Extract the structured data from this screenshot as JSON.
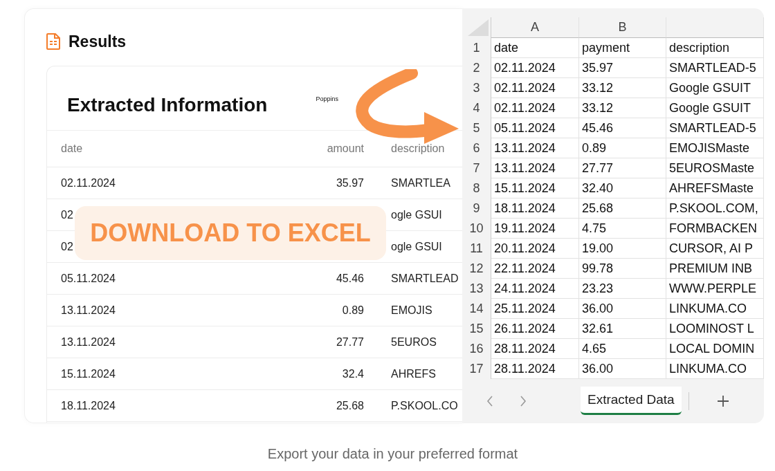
{
  "results": {
    "title": "Results",
    "card": {
      "title": "Extracted Information",
      "font_label": "Poppins",
      "table": {
        "columns": [
          "date",
          "amount",
          "description"
        ],
        "rows": [
          {
            "date": "02.11.2024",
            "amount": "35.97",
            "description": "SMARTLEA"
          },
          {
            "date": "02",
            "description": "ogle GSUI"
          },
          {
            "date": "02",
            "description": "ogle GSUI"
          },
          {
            "date": "05.11.2024",
            "amount": "45.46",
            "description": "SMARTLEAD"
          },
          {
            "date": "13.11.2024",
            "amount": "0.89",
            "description": "EMOJIS"
          },
          {
            "date": "13.11.2024",
            "amount": "27.77",
            "description": "5EUROS"
          },
          {
            "date": "15.11.2024",
            "amount": "32.4",
            "description": "AHREFS"
          },
          {
            "date": "18.11.2024",
            "amount": "25.68",
            "description": "P.SKOOL.CO"
          }
        ]
      }
    }
  },
  "banner": {
    "text": "DOWNLOAD TO EXCEL"
  },
  "spreadsheet": {
    "columns": [
      "A",
      "B"
    ],
    "rows": [
      {
        "number": "1",
        "cells": [
          "date",
          "payment",
          "description"
        ]
      },
      {
        "number": "2",
        "cells": [
          "02.11.2024",
          "35.97",
          "SMARTLEAD-5"
        ]
      },
      {
        "number": "3",
        "cells": [
          "02.11.2024",
          "33.12",
          "Google GSUIT"
        ]
      },
      {
        "number": "4",
        "cells": [
          "02.11.2024",
          "33.12",
          "Google GSUIT"
        ]
      },
      {
        "number": "5",
        "cells": [
          "05.11.2024",
          "45.46",
          "SMARTLEAD-5"
        ]
      },
      {
        "number": "6",
        "cells": [
          "13.11.2024",
          "0.89",
          "EMOJISMaste"
        ]
      },
      {
        "number": "7",
        "cells": [
          "13.11.2024",
          "27.77",
          "5EUROSMaste"
        ]
      },
      {
        "number": "8",
        "cells": [
          "15.11.2024",
          "32.40",
          "AHREFSMaste"
        ]
      },
      {
        "number": "9",
        "cells": [
          "18.11.2024",
          "25.68",
          "P.SKOOL.COM,"
        ]
      },
      {
        "number": "10",
        "cells": [
          "19.11.2024",
          "4.75",
          "FORMBACKEN"
        ]
      },
      {
        "number": "11",
        "cells": [
          "20.11.2024",
          "19.00",
          "CURSOR, AI P"
        ]
      },
      {
        "number": "12",
        "cells": [
          "22.11.2024",
          "99.78",
          "PREMIUM INB"
        ]
      },
      {
        "number": "13",
        "cells": [
          "24.11.2024",
          "23.23",
          "WWW.PERPLE"
        ]
      },
      {
        "number": "14",
        "cells": [
          "25.11.2024",
          "36.00",
          "LINKUMA.CO"
        ]
      },
      {
        "number": "15",
        "cells": [
          "26.11.2024",
          "32.61",
          "LOOMINOST L"
        ]
      },
      {
        "number": "16",
        "cells": [
          "28.11.2024",
          "4.65",
          "LOCAL DOMIN"
        ]
      },
      {
        "number": "17",
        "cells": [
          "28.11.2024",
          "36.00",
          "LINKUMA.CO"
        ]
      }
    ],
    "sheet_tabs": [
      {
        "label": "Extracted Data",
        "selected": true
      }
    ]
  },
  "caption": "Export your data in your preferred format"
}
